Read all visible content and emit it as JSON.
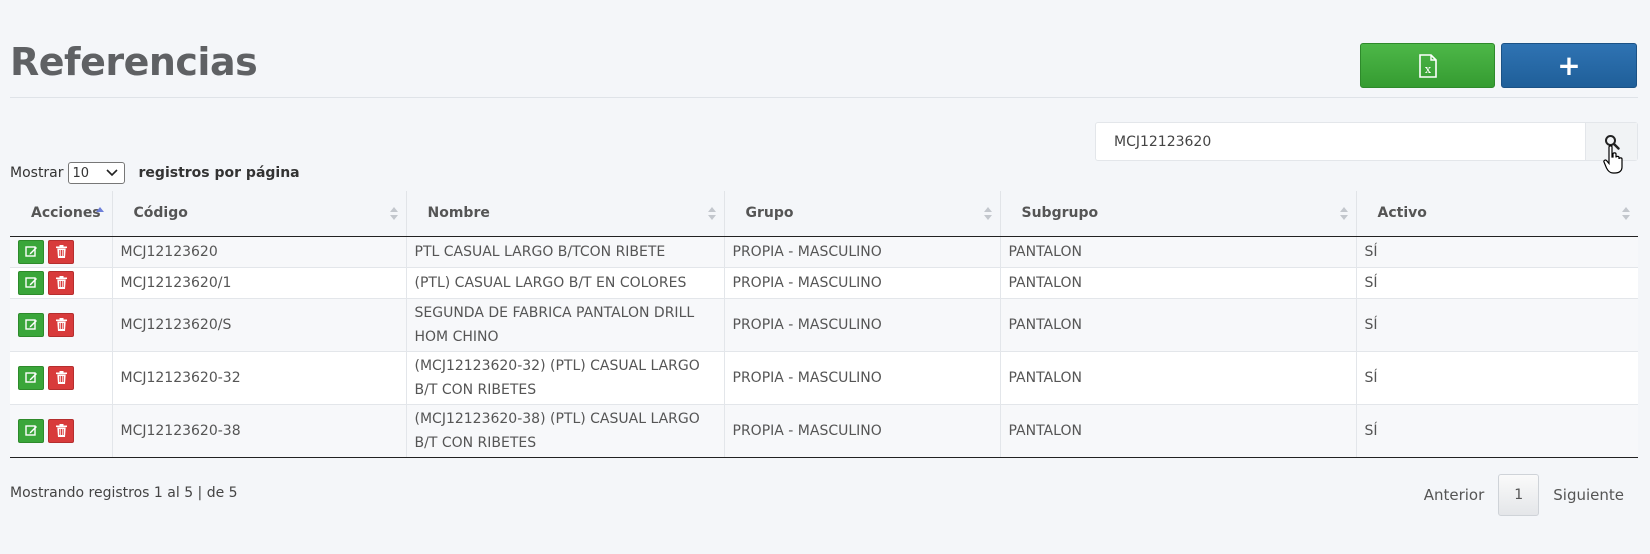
{
  "header": {
    "title": "Referencias",
    "excel_icon": "file-excel-icon",
    "add_label": "+"
  },
  "search": {
    "value": "MCJ12123620",
    "icon": "search-icon"
  },
  "length_menu": {
    "prefix": "Mostrar",
    "selected": "10",
    "suffix": "registros por página"
  },
  "table": {
    "columns": [
      "Acciones",
      "Código",
      "Nombre",
      "Grupo",
      "Subgrupo",
      "Activo"
    ],
    "sorted_column": "Acciones",
    "rows": [
      {
        "codigo": "MCJ12123620",
        "nombre": "PTL CASUAL LARGO B/TCON RIBETE",
        "grupo": "PROPIA - MASCULINO",
        "subgrupo": "PANTALON",
        "activo": "SÍ"
      },
      {
        "codigo": "MCJ12123620/1",
        "nombre": "(PTL) CASUAL LARGO B/T EN COLORES",
        "grupo": "PROPIA - MASCULINO",
        "subgrupo": "PANTALON",
        "activo": "SÍ"
      },
      {
        "codigo": "MCJ12123620/S",
        "nombre": "SEGUNDA DE FABRICA PANTALON DRILL HOM CHINO",
        "grupo": "PROPIA - MASCULINO",
        "subgrupo": "PANTALON",
        "activo": "SÍ"
      },
      {
        "codigo": "MCJ12123620-32",
        "nombre": "(MCJ12123620-32) (PTL) CASUAL LARGO B/T CON RIBETES",
        "grupo": "PROPIA - MASCULINO",
        "subgrupo": "PANTALON",
        "activo": "SÍ"
      },
      {
        "codigo": "MCJ12123620-38",
        "nombre": "(MCJ12123620-38) (PTL) CASUAL LARGO B/T CON RIBETES",
        "grupo": "PROPIA - MASCULINO",
        "subgrupo": "PANTALON",
        "activo": "SÍ"
      }
    ]
  },
  "footer": {
    "info": "Mostrando registros 1 al 5 | de 5",
    "prev": "Anterior",
    "page": "1",
    "next": "Siguiente"
  },
  "colors": {
    "excel_button": "#3da83a",
    "add_button": "#2568a6",
    "edit_button": "#3aa63a",
    "delete_button": "#d83b3b",
    "background": "#f4f6f9"
  }
}
